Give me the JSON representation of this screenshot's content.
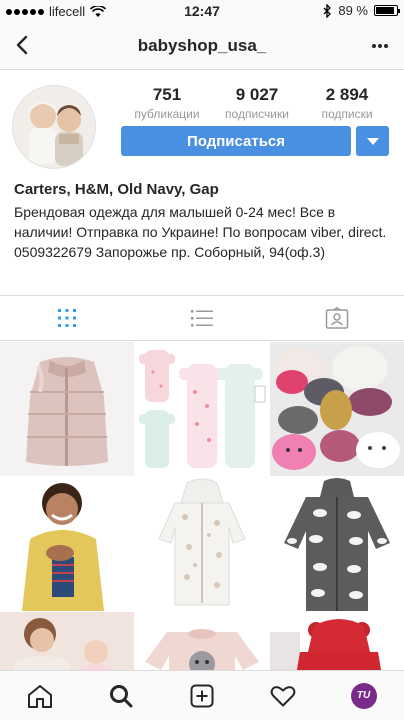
{
  "status_bar": {
    "carrier": "lifecell",
    "time": "12:47",
    "battery": "89 %"
  },
  "header": {
    "username": "babyshop_usa_"
  },
  "profile": {
    "stats": [
      {
        "number": "751",
        "label": "публикации"
      },
      {
        "number": "9 027",
        "label": "подписчики"
      },
      {
        "number": "2 894",
        "label": "подписки"
      }
    ],
    "follow_label": "Подписаться",
    "name": "Carters, H&M, Old Navy, Gap",
    "bio": "Брендовая одежда для малышей 0-24 мес! Все в наличии! Отправка по Украине! По вопросам viber, direct. 0509322679 Запорожье пр. Соборный, 94(оф.3)"
  },
  "tabs": [
    {
      "icon": "grid-icon",
      "active": true
    },
    {
      "icon": "list-icon",
      "active": false
    },
    {
      "icon": "tagged-icon",
      "active": false
    }
  ],
  "grid": [
    {
      "subject": "pink-puffer-vest"
    },
    {
      "subject": "baby-sleepsuits-set"
    },
    {
      "subject": "knit-hats-collection"
    },
    {
      "subject": "boy-yellow-jacket"
    },
    {
      "subject": "white-printed-onesie"
    },
    {
      "subject": "grey-cloud-romper"
    },
    {
      "subject": "mom-and-baby"
    },
    {
      "subject": "pink-sweatshirt"
    },
    {
      "subject": "red-hooded-jacket"
    }
  ],
  "bottom_nav": [
    {
      "icon": "home-icon"
    },
    {
      "icon": "search-icon"
    },
    {
      "icon": "add-post-icon"
    },
    {
      "icon": "heart-icon"
    },
    {
      "icon": "profile-avatar",
      "avatar_text": "TU"
    }
  ],
  "colors": {
    "accent": "#4a90e2",
    "active_tab": "#3897f0",
    "inactive_icon": "#999999"
  }
}
